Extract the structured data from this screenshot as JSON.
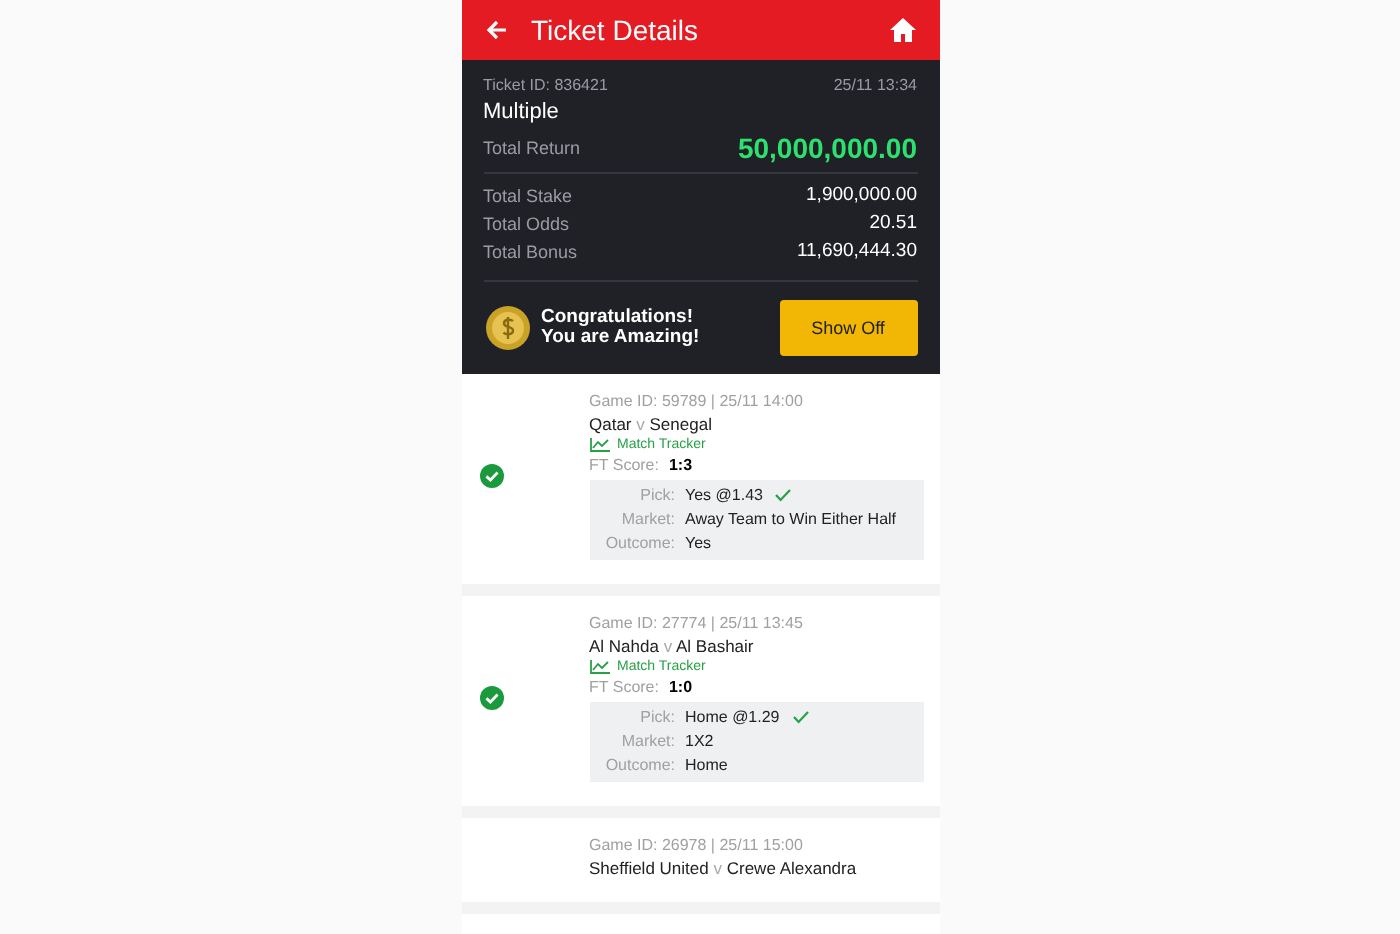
{
  "header": {
    "title": "Ticket Details"
  },
  "ticket": {
    "id": "Ticket ID: 836421",
    "time": "25/11 13:34",
    "type": "Multiple",
    "return_label": "Total Return",
    "return_value": "50,000,000.00",
    "totals": [
      {
        "label": "Total Stake",
        "value": "1,900,000.00"
      },
      {
        "label": "Total Odds",
        "value": "20.51"
      },
      {
        "label": "Total Bonus",
        "value": "11,690,444.30"
      }
    ]
  },
  "banner": {
    "lines": [
      "Congratulations!",
      "You are Amazing!"
    ],
    "button": "Show Off"
  },
  "games": [
    {
      "won": true,
      "meta": "Game ID: 59789 | 25/11 14:00",
      "home": "Qatar",
      "sep": "v",
      "away": "Senegal",
      "tracker": "Match Tracker",
      "score_label": "FT Score:",
      "score": "1:3",
      "details": [
        {
          "label": "Pick:",
          "value": "Yes @1.43",
          "checked": true
        },
        {
          "label": "Market:",
          "value": "Away Team to Win Either Half",
          "checked": false
        },
        {
          "label": "Outcome:",
          "value": "Yes",
          "checked": false
        }
      ]
    },
    {
      "won": true,
      "meta": "Game ID: 27774 | 25/11 13:45",
      "home": "Al Nahda",
      "sep": "v",
      "away": "Al Bashair",
      "tracker": "Match Tracker",
      "score_label": "FT Score:",
      "score": "1:0",
      "details": [
        {
          "label": "Pick:",
          "value": "Home @1.29",
          "checked": true
        },
        {
          "label": "Market:",
          "value": "1X2",
          "checked": false
        },
        {
          "label": "Outcome:",
          "value": "Home",
          "checked": false
        }
      ]
    },
    {
      "won": false,
      "meta": "Game ID: 26978 | 25/11 15:00",
      "home": "Sheffield United",
      "sep": "v",
      "away": "Crewe Alexandra"
    }
  ]
}
